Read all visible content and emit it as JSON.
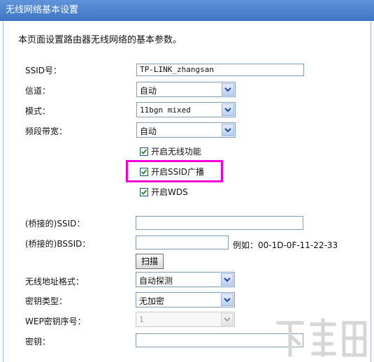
{
  "header": {
    "title": "无线网络基本设置"
  },
  "description": "本页面设置路由器无线网络的基本参数。",
  "fields": {
    "ssid": {
      "label": "SSID号：",
      "value": "TP-LINK_zhangsan"
    },
    "channel": {
      "label": "信道：",
      "value": "自动"
    },
    "mode": {
      "label": "模式：",
      "value": "11bgn mixed"
    },
    "bandwidth": {
      "label": "频段带宽：",
      "value": "自动"
    },
    "bridge_ssid": {
      "label": "(桥接的)SSID：",
      "value": ""
    },
    "bridge_bssid": {
      "label": "(桥接的)BSSID：",
      "value": "",
      "example": "例如：00-1D-0F-11-22-33"
    },
    "scan_button": "扫描",
    "mac_format": {
      "label": "无线地址格式：",
      "value": "自动探测"
    },
    "key_type": {
      "label": "密钥类型：",
      "value": "无加密"
    },
    "wep_index": {
      "label": "WEP密钥序号：",
      "value": "1"
    },
    "key": {
      "label": "密钥：",
      "value": ""
    }
  },
  "checkboxes": {
    "enable_wireless": {
      "label": "开启无线功能",
      "checked": true
    },
    "enable_ssid_broadcast": {
      "label": "开启SSID广播",
      "checked": true
    },
    "enable_wds": {
      "label": "开启WDS",
      "checked": true
    }
  },
  "colors": {
    "header": "#4a7fcb",
    "highlight": "#f000d8"
  },
  "icons": {
    "dropdown": "chevron-down-icon",
    "check": "checkmark-icon"
  }
}
